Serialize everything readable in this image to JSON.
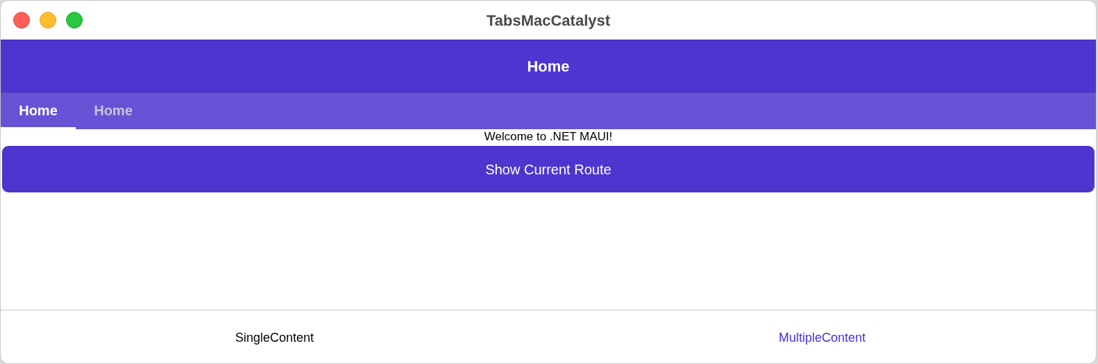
{
  "window": {
    "title": "TabsMacCatalyst"
  },
  "nav_bar": {
    "title": "Home"
  },
  "top_tabs": [
    {
      "label": "Home",
      "selected": true
    },
    {
      "label": "Home",
      "selected": false
    }
  ],
  "content": {
    "welcome": "Welcome to .NET MAUI!",
    "button": "Show Current Route"
  },
  "bottom_tabs": [
    {
      "label": "SingleContent",
      "selected": false
    },
    {
      "label": "MultipleContent",
      "selected": true
    }
  ]
}
